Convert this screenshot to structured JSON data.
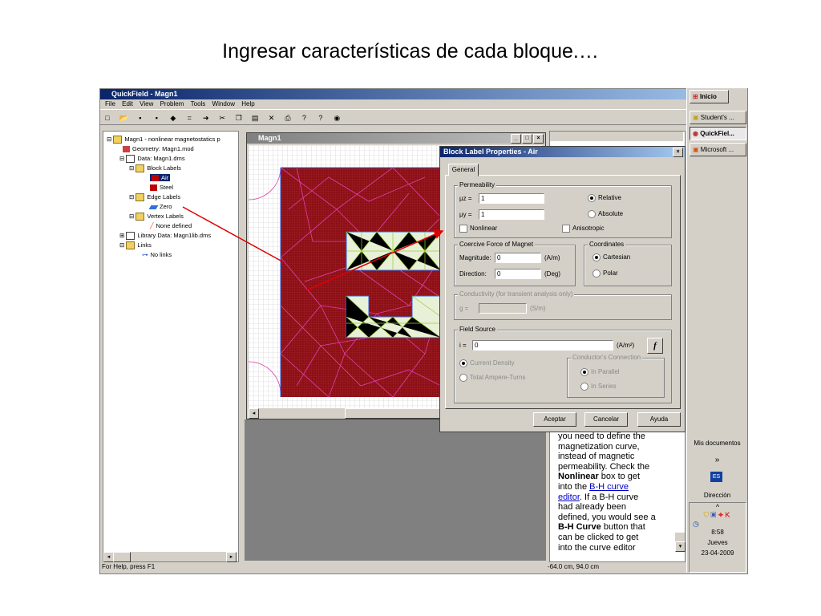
{
  "slide": {
    "title": "Ingresar características de cada bloque.…"
  },
  "app": {
    "title": "QuickField - Magn1",
    "menu": [
      "File",
      "Edit",
      "View",
      "Problem",
      "Tools",
      "Window",
      "Help"
    ],
    "tree": {
      "root": "Magn1 - nonlinear magnetostatics p",
      "geometry": "Geometry: Magn1.mod",
      "data": "Data: Magn1.dms",
      "block_labels": "Block Labels",
      "air": "Air",
      "steel": "Steel",
      "edge_labels": "Edge Labels",
      "zero": "Zero",
      "vertex_labels": "Vertex Labels",
      "none_defined": "None defined",
      "library": "Library Data: Magn1lib.dms",
      "links": "Links",
      "no_links": "No links"
    },
    "model_window_title": "Magn1",
    "status_left": "For Help, press F1",
    "status_coords": "-64.0 cm, 94.0 cm"
  },
  "dialog": {
    "title": "Block Label Properties - Air",
    "tab": "General",
    "permeability": {
      "group": "Permeability",
      "mu_z_label": "μz =",
      "mu_z": "1",
      "mu_y_label": "μy =",
      "mu_y": "1",
      "relative": "Relative",
      "absolute": "Absolute",
      "nonlinear": "Nonlinear",
      "anisotropic": "Anisotropic"
    },
    "coercive": {
      "group": "Coercive Force of Magnet",
      "magnitude_label": "Magnitude:",
      "magnitude": "0",
      "magnitude_unit": "(A/m)",
      "direction_label": "Direction:",
      "direction": "0",
      "direction_unit": "(Deg)"
    },
    "coordinates": {
      "group": "Coordinates",
      "cartesian": "Cartesian",
      "polar": "Polar"
    },
    "conductivity": {
      "group": "Conductivity (for transient analysis only)",
      "g_label": "g =",
      "unit": "(S/m)"
    },
    "field_source": {
      "group": "Field Source",
      "i_label": "i =",
      "i": "0",
      "unit": "(A/m²)",
      "f_button": "f",
      "current_density": "Current Density",
      "total_ampere_turns": "Total Ampere-Turns",
      "conductors_connection": "Conductor's Connection",
      "in_parallel": "In Parallel",
      "in_series": "In Series"
    },
    "buttons": {
      "accept": "Aceptar",
      "cancel": "Cancelar",
      "help": "Ayuda"
    }
  },
  "help_text": {
    "l1": "you need to define the",
    "l2": "magnetization curve,",
    "l3": "instead of magnetic",
    "l4": "permeability. Check the",
    "l5_bold": "Nonlinear",
    "l5_rest": " box to get",
    "l6_pre": "into the ",
    "l6_link": "B-H curve",
    "l7_link": "editor",
    "l7_rest": ". If a B-H curve",
    "l8": "had already been",
    "l9": "defined, you would see a",
    "l10_bold": "B-H Curve",
    "l10_rest": " button that",
    "l11": "can be clicked to get",
    "l12": "into the curve editor"
  },
  "taskbar": {
    "start": "Inicio",
    "items": [
      "Student's ...",
      "QuickFiel...",
      "Microsoft ..."
    ],
    "my_documents": "Mis documentos",
    "chevron": "»",
    "lang": "ES",
    "address": "Dirección",
    "up": "^",
    "time": "8:58",
    "day": "Jueves",
    "date": "23-04-2009"
  },
  "colors": {
    "mesh_bg": "#8b0f14",
    "mesh_lines": "#e040b0",
    "steel_fill": "#e8f0d8",
    "steel_mesh": "#9acd32",
    "arrow": "#e00000"
  }
}
